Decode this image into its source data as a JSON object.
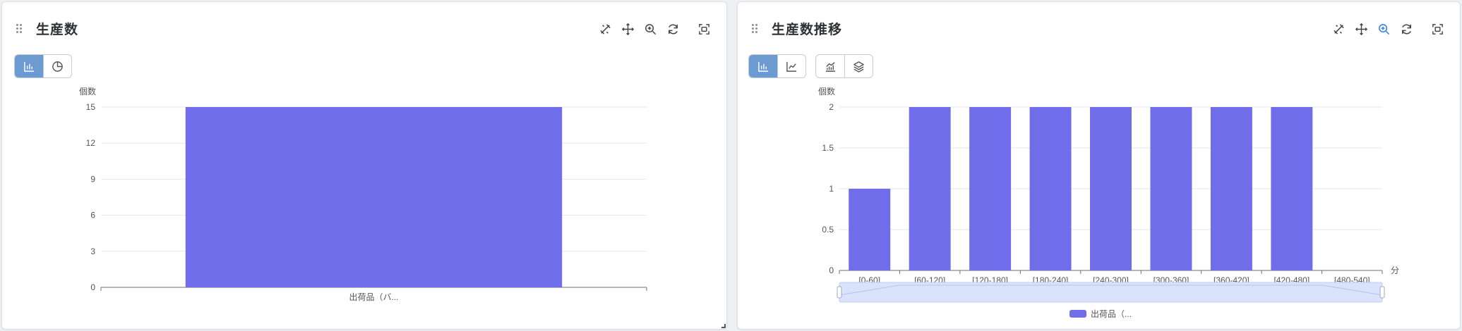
{
  "panels": [
    {
      "title": "生産数",
      "tools": [
        {
          "name": "brush-icon"
        },
        {
          "name": "move-icon"
        },
        {
          "name": "zoom-in-icon"
        },
        {
          "name": "refresh-icon"
        },
        {
          "name": "screenshot-icon"
        }
      ],
      "buttons": [
        {
          "name": "bar-chart-icon",
          "active": true
        },
        {
          "name": "pie-chart-icon",
          "active": false
        }
      ]
    },
    {
      "title": "生産数推移",
      "tools": [
        {
          "name": "brush-icon"
        },
        {
          "name": "move-icon"
        },
        {
          "name": "zoom-in-icon",
          "highlight": true
        },
        {
          "name": "refresh-icon"
        },
        {
          "name": "screenshot-icon"
        }
      ],
      "buttons": [
        {
          "name": "bar-chart-icon",
          "active": true
        },
        {
          "name": "line-chart-icon",
          "active": false
        }
      ],
      "buttons2": [
        {
          "name": "trend-chart-icon",
          "active": false
        },
        {
          "name": "stack-layers-icon",
          "active": false
        }
      ]
    }
  ],
  "chart_data": [
    {
      "type": "bar",
      "ylabel": "個数",
      "xlabel": "",
      "categories": [
        "出荷品（バ..."
      ],
      "series": [
        {
          "values": [
            15
          ]
        }
      ],
      "ylim": [
        0,
        15
      ],
      "yticks": [
        0,
        3,
        6,
        9,
        12,
        15
      ],
      "grid": true,
      "color": "#6f6de9"
    },
    {
      "type": "bar",
      "ylabel": "個数",
      "xlabel": "分",
      "categories": [
        "[0-60]",
        "[60-120]",
        "[120-180]",
        "[180-240]",
        "[240-300]",
        "[300-360]",
        "[360-420]",
        "[420-480]",
        "[480-540]"
      ],
      "series": [
        {
          "name": "出荷品（...",
          "values": [
            1,
            2,
            2,
            2,
            2,
            2,
            2,
            2,
            0
          ]
        }
      ],
      "ylim": [
        0,
        2
      ],
      "yticks": [
        0,
        0.5,
        1,
        1.5,
        2
      ],
      "grid": true,
      "data_zoom": true,
      "legend": "bottom-center",
      "color": "#6f6de9"
    }
  ]
}
